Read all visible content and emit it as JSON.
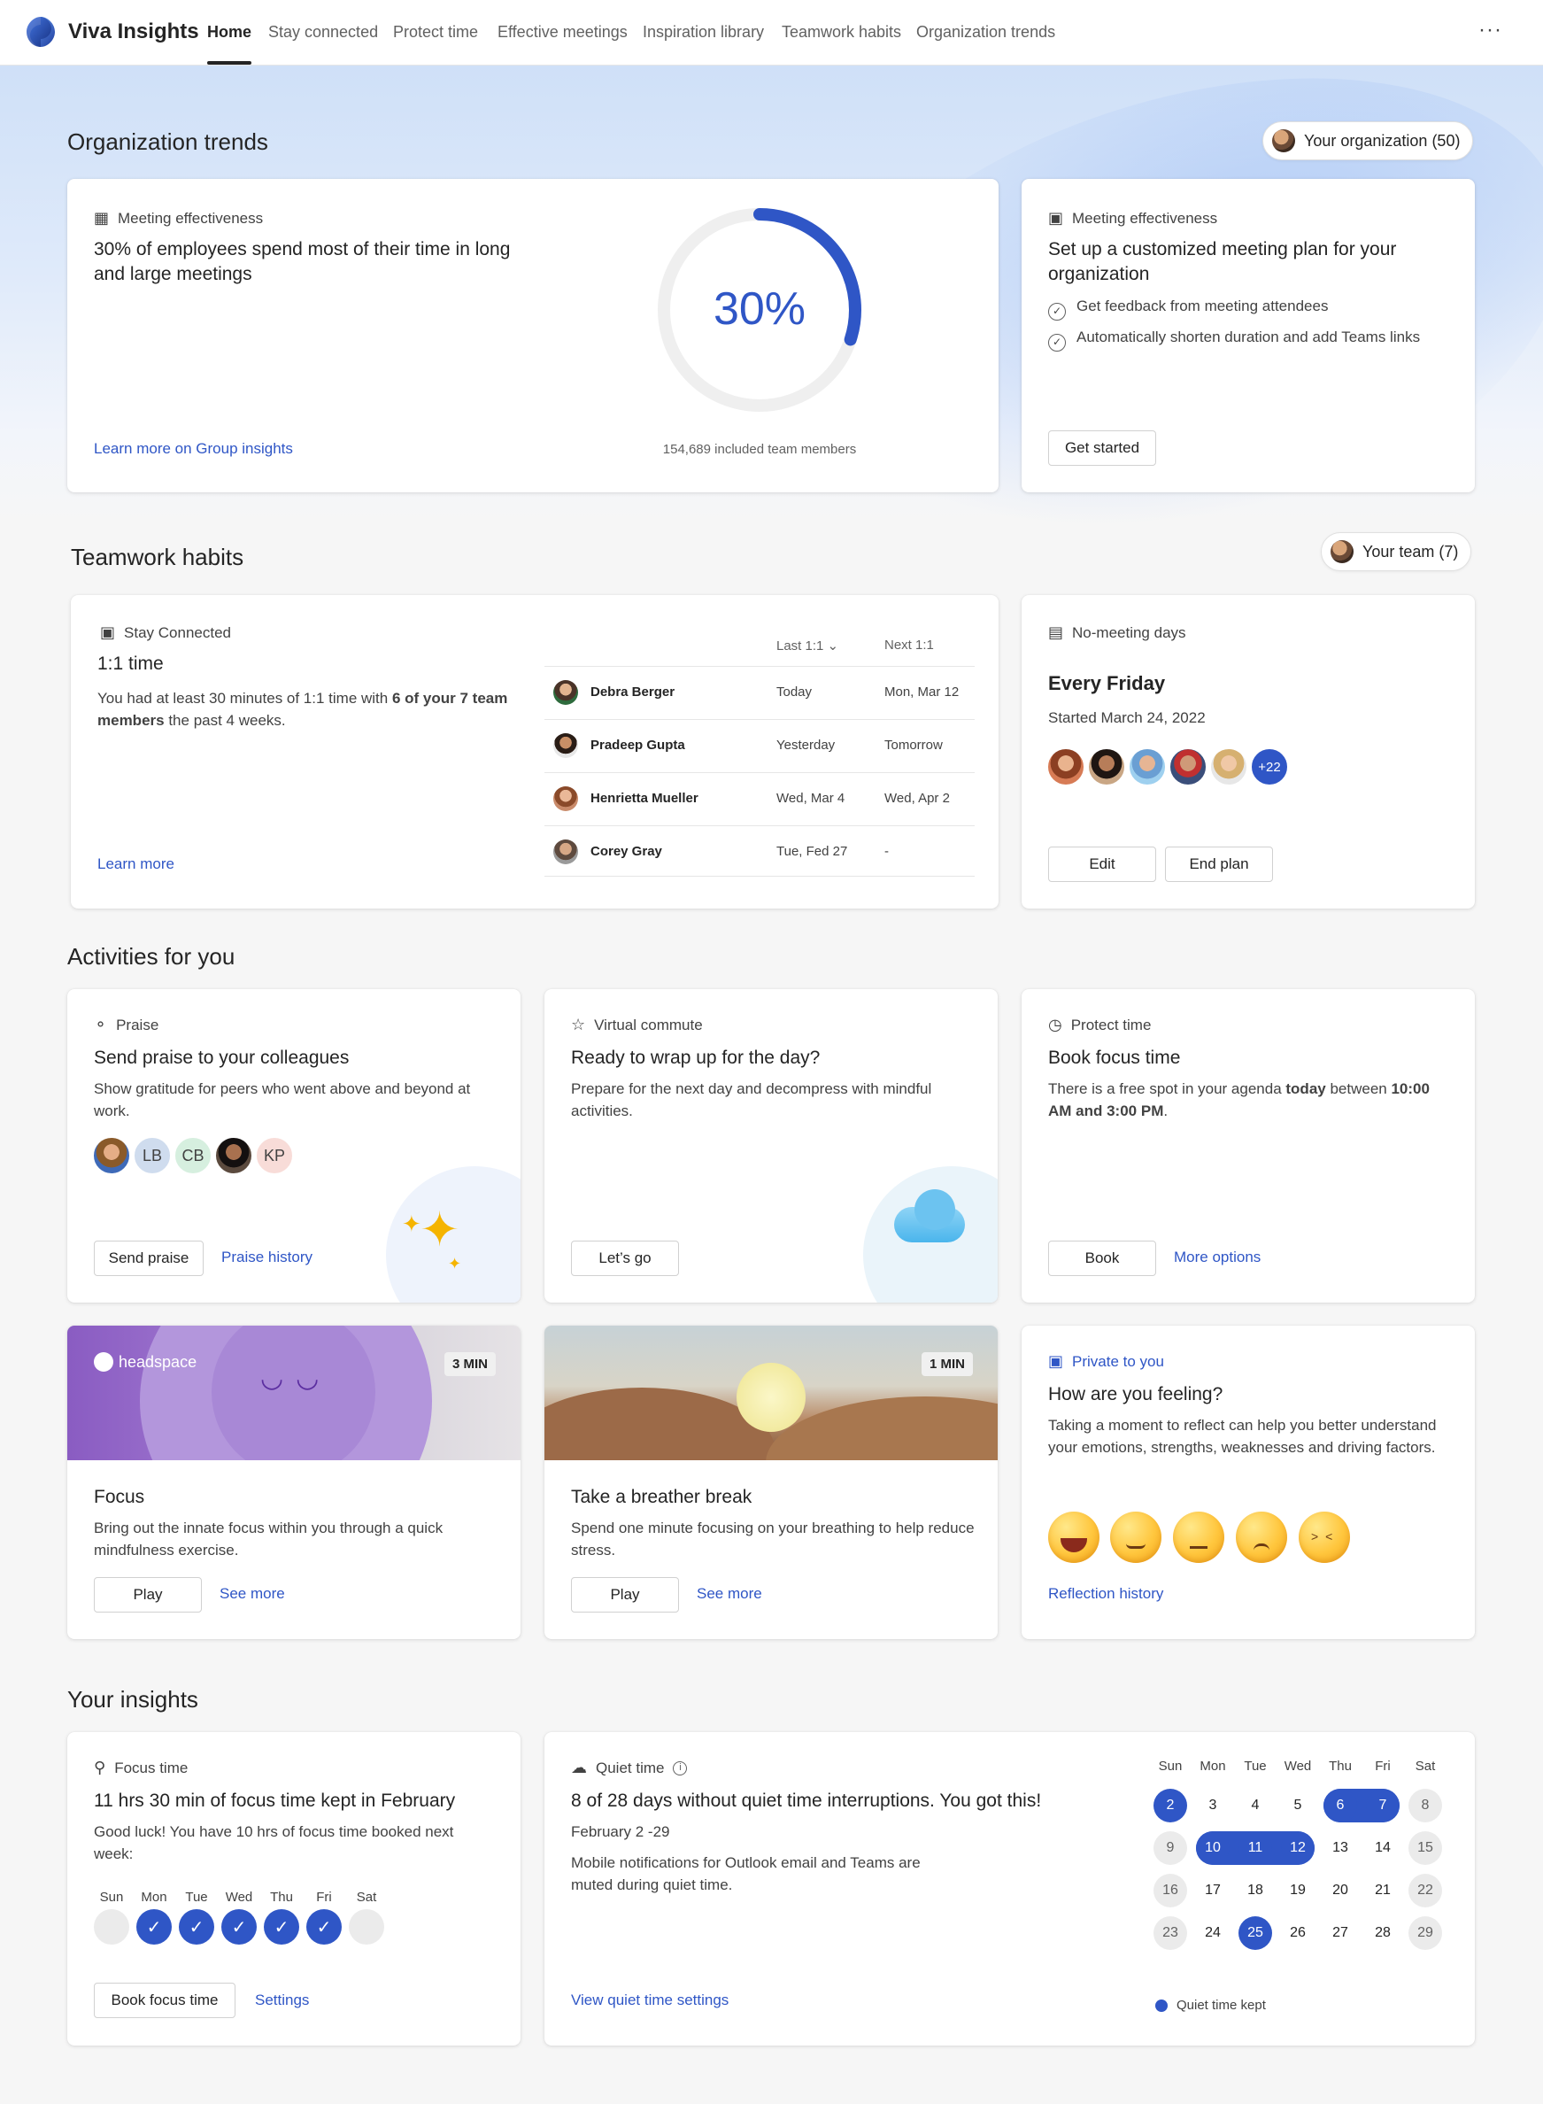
{
  "app": {
    "name": "Viva Insights"
  },
  "nav": {
    "items": [
      "Home",
      "Stay connected",
      "Protect time",
      "Effective meetings",
      "Inspiration library",
      "Teamwork habits",
      "Organization trends"
    ],
    "more_label": "···"
  },
  "org_trends": {
    "title": "Organization trends",
    "pill": "Your organization (50)",
    "card1": {
      "eyebrow": "Meeting effectiveness",
      "headline": "30% of employees spend most of their time in long and large meetings",
      "percent_label": "30%",
      "percent_value": 30,
      "members": "154,689 included team members",
      "link": "Learn more on Group insights"
    },
    "card2": {
      "eyebrow": "Meeting effectiveness",
      "headline": "Set up a customized meeting plan for your organization",
      "items": [
        "Get feedback from meeting attendees",
        "Automatically shorten duration and add Teams links"
      ],
      "button": "Get started"
    }
  },
  "teamwork": {
    "title": "Teamwork habits",
    "pill": "Your team (7)",
    "card1": {
      "eyebrow": "Stay Connected",
      "headline": "1:1 time",
      "body_pre": "You had at least 30 minutes of 1:1 time with ",
      "body_bold": "6 of your 7 team members",
      "body_post": " the past 4 weeks.",
      "link": "Learn more",
      "col_last": "Last 1:1",
      "col_next": "Next 1:1",
      "rows": [
        {
          "name": "Debra Berger",
          "last": "Today",
          "next": "Mon, Mar 12"
        },
        {
          "name": "Pradeep Gupta",
          "last": "Yesterday",
          "next": "Tomorrow"
        },
        {
          "name": "Henrietta Mueller",
          "last": "Wed, Mar 4",
          "next": "Wed, Apr 2"
        },
        {
          "name": "Corey Gray",
          "last": "Tue, Fed 27",
          "next": "-"
        }
      ]
    },
    "card2": {
      "eyebrow": "No-meeting days",
      "headline": "Every Friday",
      "sub": "Started March 24, 2022",
      "more_count": "+22",
      "edit": "Edit",
      "end": "End plan"
    }
  },
  "activities": {
    "title": "Activities for you",
    "praise": {
      "eyebrow": "Praise",
      "headline": "Send praise to your colleagues",
      "body": "Show gratitude for peers who went above and beyond at work.",
      "initials": [
        "LB",
        "CB",
        "KP"
      ],
      "button": "Send praise",
      "link": "Praise history"
    },
    "commute": {
      "eyebrow": "Virtual commute",
      "headline": "Ready to wrap up for the day?",
      "body": "Prepare for the next day and decompress with mindful activities.",
      "button": "Let’s go"
    },
    "protect": {
      "eyebrow": "Protect time",
      "headline": "Book focus time",
      "body_pre": "There is a free spot in your agenda ",
      "body_b1": "today",
      "body_mid": " between ",
      "body_b2": "10:00 AM and 3:00 PM",
      "body_post": ".",
      "button": "Book",
      "link": "More options"
    },
    "focus": {
      "brand": "headspace",
      "badge": "3 MIN",
      "headline": "Focus",
      "body": "Bring out the innate focus within you through a quick mindfulness exercise.",
      "button": "Play",
      "link": "See more"
    },
    "breather": {
      "badge": "1 MIN",
      "headline": "Take a breather break",
      "body": "Spend one minute focusing on your breathing to help reduce stress.",
      "button": "Play",
      "link": "See more"
    },
    "feeling": {
      "eyebrow": "Private to you",
      "headline": "How are you feeling?",
      "body": "Taking a moment to reflect can help you better understand your emotions, strengths, weaknesses and driving factors.",
      "link": "Reflection history"
    }
  },
  "insights": {
    "title": "Your insights",
    "focus": {
      "eyebrow": "Focus time",
      "headline": "11 hrs 30 min of focus time kept in February",
      "body": "Good luck! You have 10 hrs of focus time booked next week:",
      "days": [
        "Sun",
        "Mon",
        "Tue",
        "Wed",
        "Thu",
        "Fri",
        "Sat"
      ],
      "booked": [
        false,
        true,
        true,
        true,
        true,
        true,
        false
      ],
      "button": "Book focus time",
      "link": "Settings"
    },
    "quiet": {
      "eyebrow": "Quiet time",
      "headline": "8 of 28 days without quiet time interruptions. You got this!",
      "range": "February 2 -29",
      "body": "Mobile notifications for Outlook email and Teams are muted during quiet time.",
      "link": "View quiet time settings",
      "legend": "Quiet time kept",
      "weekdays": [
        "Sun",
        "Mon",
        "Tue",
        "Wed",
        "Thu",
        "Fri",
        "Sat"
      ],
      "weeks": [
        [
          "2",
          "3",
          "4",
          "5",
          "6",
          "7",
          "8"
        ],
        [
          "9",
          "10",
          "11",
          "12",
          "13",
          "14",
          "15"
        ],
        [
          "16",
          "17",
          "18",
          "19",
          "20",
          "21",
          "22"
        ],
        [
          "23",
          "24",
          "25",
          "26",
          "27",
          "28",
          "29"
        ]
      ],
      "kept_days": [
        "2",
        "6",
        "7",
        "10",
        "11",
        "12",
        "25"
      ]
    }
  },
  "colors": {
    "accent": "#2f56c6",
    "text": "#242424",
    "muted": "#616161"
  }
}
